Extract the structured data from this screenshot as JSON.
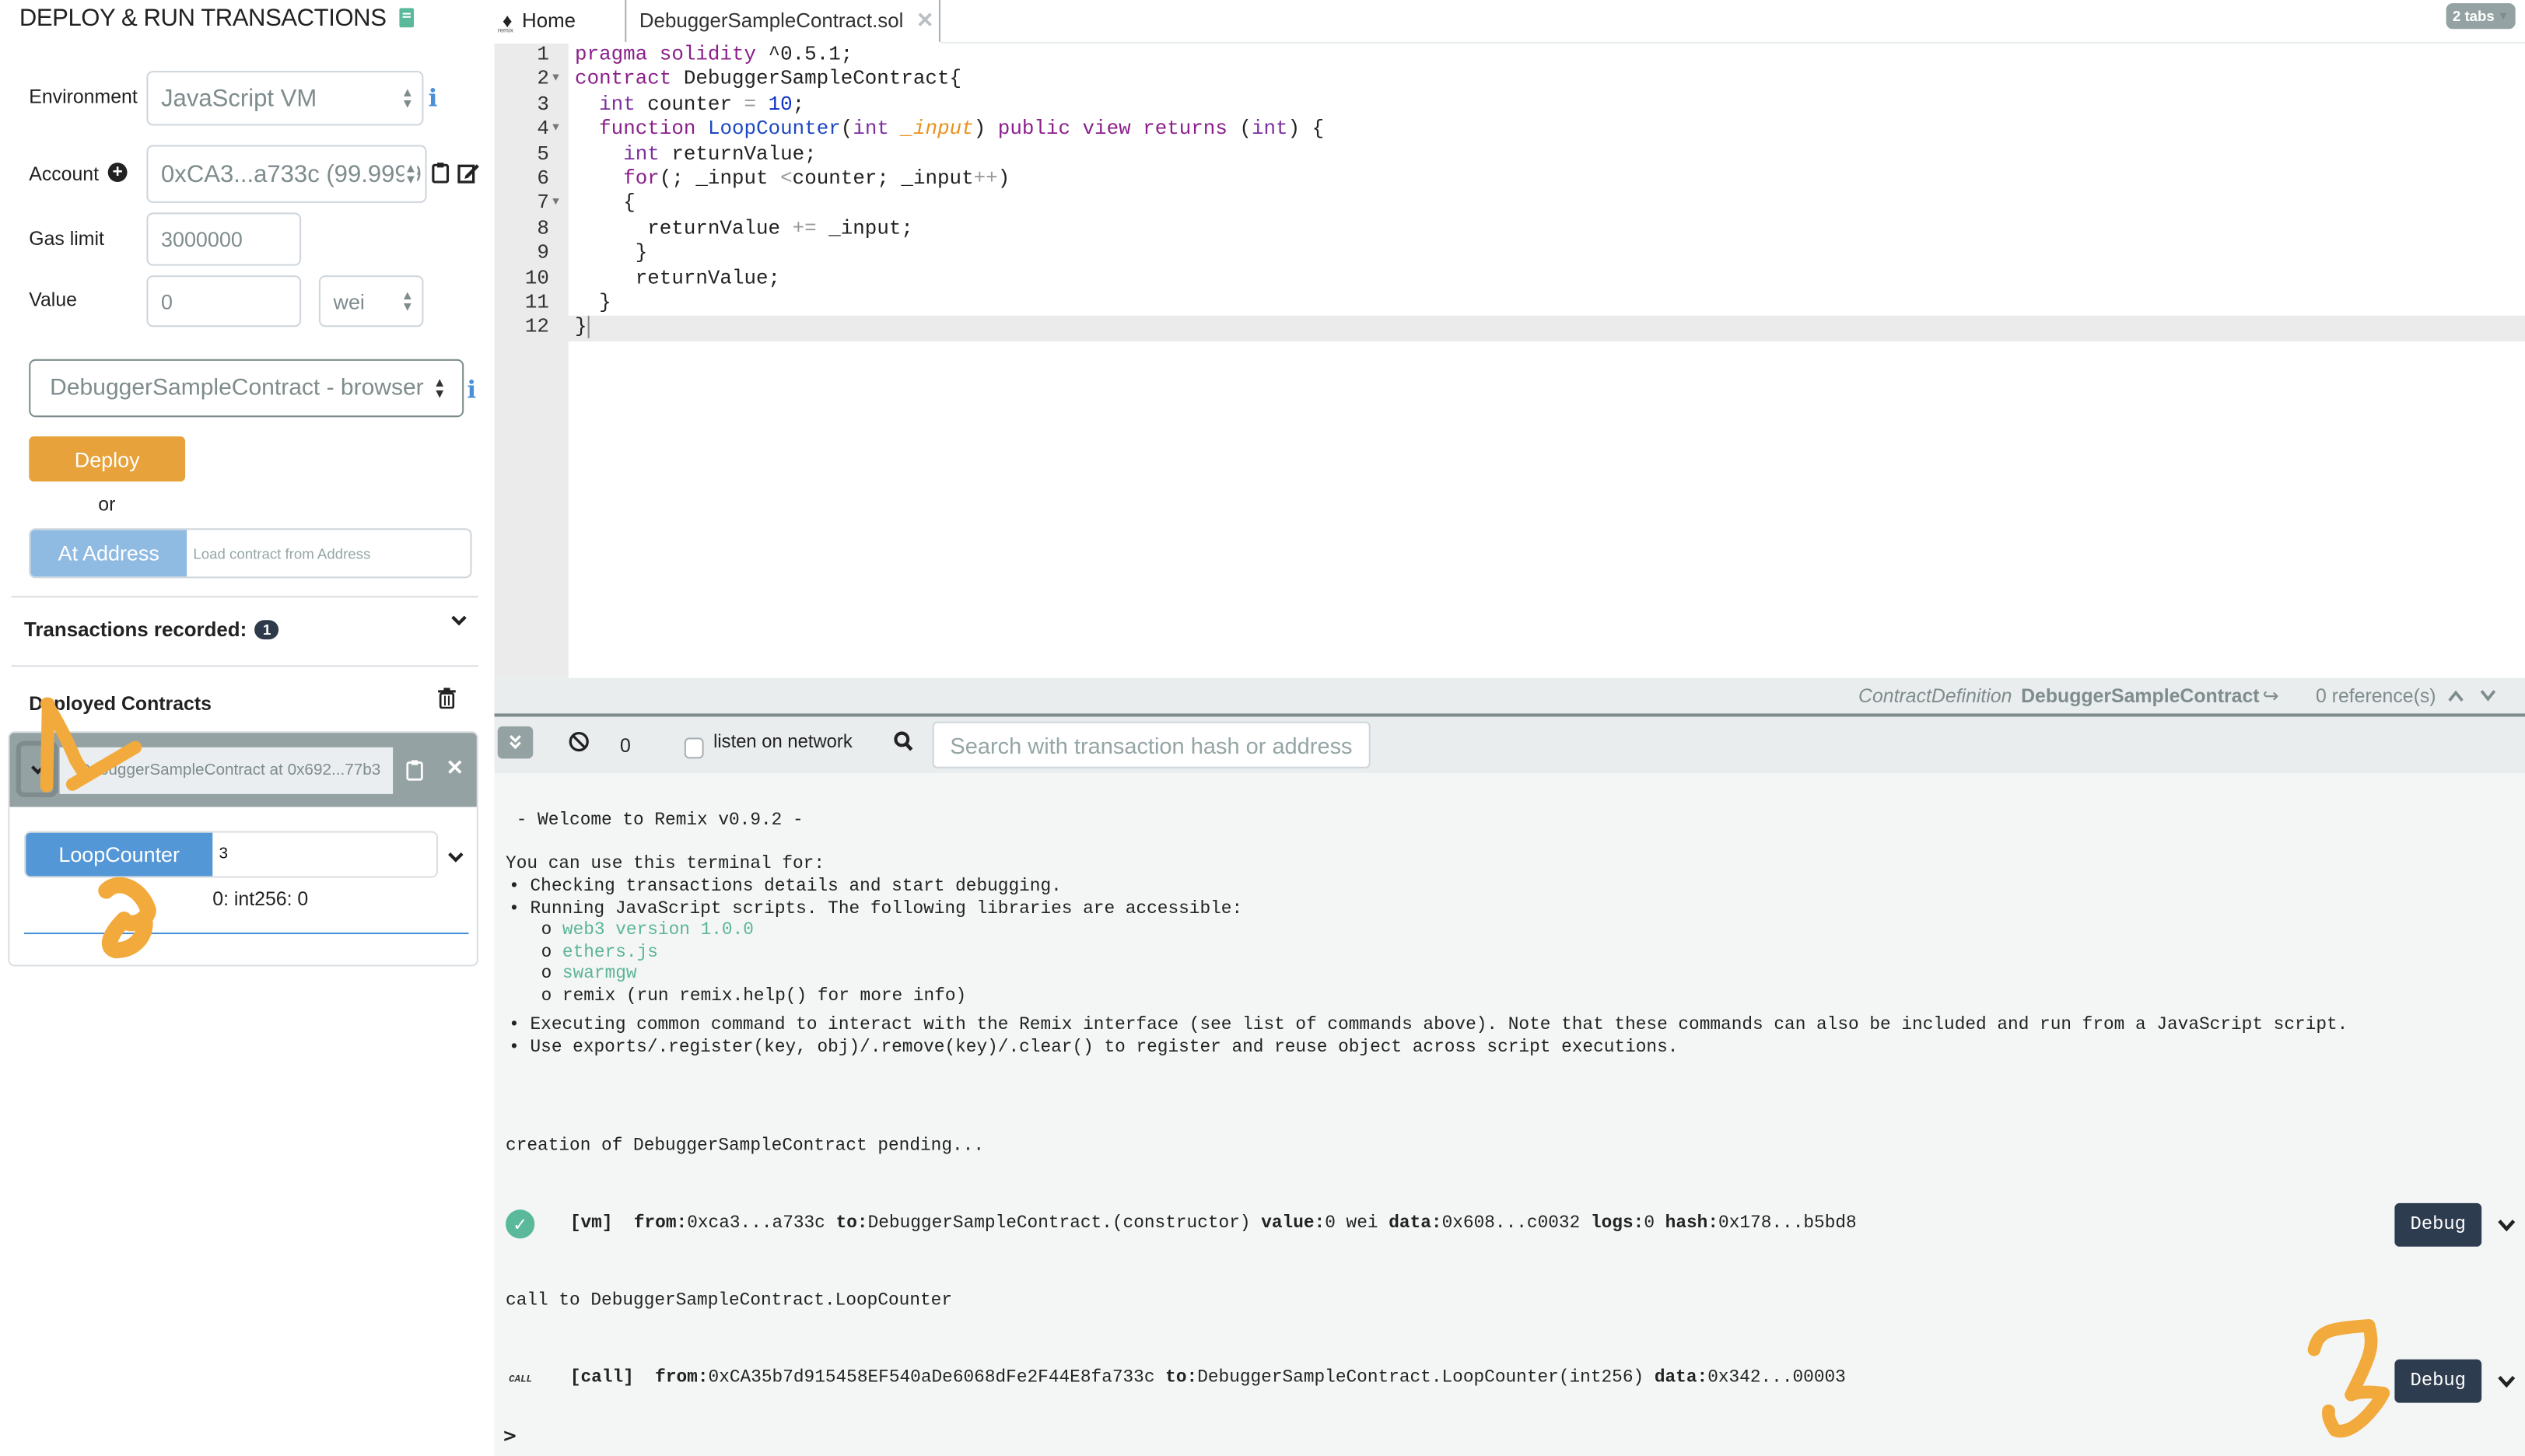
{
  "left_panel": {
    "title": "DEPLOY & RUN TRANSACTIONS",
    "environment": {
      "label": "Environment",
      "value": "JavaScript VM"
    },
    "account": {
      "label": "Account",
      "value": "0xCA3...a733c (99.9999"
    },
    "gas_limit": {
      "label": "Gas limit",
      "value": "3000000"
    },
    "value": {
      "label": "Value",
      "amount": "0",
      "unit": "wei"
    },
    "contract_select": "DebuggerSampleContract - browser",
    "deploy_label": "Deploy",
    "or_label": "or",
    "at_address_label": "At Address",
    "at_address_placeholder": "Load contract from Address",
    "transactions_recorded_label": "Transactions recorded:",
    "transactions_recorded_count": "1",
    "deployed_contracts_label": "Deployed Contracts",
    "deployed_contract": {
      "name": "DebuggerSampleContract at 0x692...77b3",
      "function_label": "LoopCounter",
      "function_input": "3",
      "result": "0: int256: 0"
    }
  },
  "tabs": {
    "home_label": "Home",
    "home_logo_caption": "remix",
    "file_label": "DebuggerSampleContract.sol",
    "tabs_count_label": "2 tabs"
  },
  "editor": {
    "lines": [
      {
        "n": "1",
        "fold": false
      },
      {
        "n": "2",
        "fold": true
      },
      {
        "n": "3",
        "fold": false
      },
      {
        "n": "4",
        "fold": true
      },
      {
        "n": "5",
        "fold": false
      },
      {
        "n": "6",
        "fold": false
      },
      {
        "n": "7",
        "fold": true
      },
      {
        "n": "8",
        "fold": false
      },
      {
        "n": "9",
        "fold": false
      },
      {
        "n": "10",
        "fold": false
      },
      {
        "n": "11",
        "fold": false
      },
      {
        "n": "12",
        "fold": false
      }
    ],
    "code": {
      "l1_kw1": "pragma",
      "l1_kw2": "solidity",
      "l1_rest": " ^0.5.1;",
      "l2_kw": "contract",
      "l2_rest": " DebuggerSampleContract{",
      "l3_type": "int",
      "l3_mid": " counter ",
      "l3_op": "=",
      "l3_num": "10",
      "l3_end": ";",
      "l4_kw": "function",
      "l4_fn": "LoopCounter",
      "l4_open": "(",
      "l4_type": "int",
      "l4_param": "_input",
      "l4_close": ")",
      "l4_mods": "public view returns",
      "l4_ret_open": " (",
      "l4_ret_type": "int",
      "l4_end": ") {",
      "l5_type": "int",
      "l5_rest": " returnValue;",
      "l6_kw": "for",
      "l6_a": "(; _input ",
      "l6_op": "<",
      "l6_b": "counter; _input",
      "l6_inc": "++",
      "l6_end": ")",
      "l7": "{",
      "l8_a": "returnValue ",
      "l8_op": "+=",
      "l8_b": " _input;",
      "l9": "}",
      "l10": "returnValue;",
      "l11": "}",
      "l12": "}"
    }
  },
  "status_bar": {
    "kind": "ContractDefinition",
    "name": "DebuggerSampleContract",
    "references": "0 reference(s)"
  },
  "terminal_bar": {
    "pending_count": "0",
    "listen_label": "listen on network",
    "listen_checked": false,
    "search_placeholder": "Search with transaction hash or address"
  },
  "terminal": {
    "welcome": " - Welcome to Remix v0.9.2 -",
    "intro": "You can use this terminal for:",
    "bullets": [
      "Checking transactions details and start debugging.",
      "Running JavaScript scripts. The following libraries are accessible:"
    ],
    "libraries": [
      "web3 version 1.0.0",
      "ethers.js",
      "swarmgw"
    ],
    "remix_lib": "remix (run remix.help() for more info)",
    "bullets2": [
      "Executing common command to interact with the Remix interface (see list of commands above). Note that these commands can also be included and run from a JavaScript script.",
      "Use exports/.register(key, obj)/.remove(key)/.clear() to register and reuse object across script executions."
    ],
    "creation_pending": "creation of DebuggerSampleContract pending...",
    "tx1": {
      "tag": "[vm]",
      "from_label": "from:",
      "from": "0xca3...a733c",
      "to_label": "to:",
      "to": "DebuggerSampleContract.(constructor)",
      "value_label": "value:",
      "value": "0 wei",
      "data_label": "data:",
      "data": "0x608...c0032",
      "logs_label": "logs:",
      "logs": "0",
      "hash_label": "hash:",
      "hash": "0x178...b5bd8"
    },
    "call_to": "call to DebuggerSampleContract.LoopCounter",
    "tx2": {
      "icon_label": "CALL",
      "tag": "[call]",
      "from_label": "from:",
      "from": "0xCA35b7d915458EF540aDe6068dFe2F44E8fa733c",
      "to_label": "to:",
      "to": "DebuggerSampleContract.LoopCounter(int256)",
      "data_label": "data:",
      "data": "0x342...00003"
    },
    "debug_label": "Debug",
    "prompt": ">"
  },
  "annotations": [
    "1",
    "2",
    "3"
  ],
  "colors": {
    "deploy": "#e8a23b",
    "at_address": "#8fbbe3",
    "function_button": "#5497d6",
    "debug_button": "#2e3c4f",
    "success": "#5ab99a",
    "annotation": "#f2aa3c"
  }
}
